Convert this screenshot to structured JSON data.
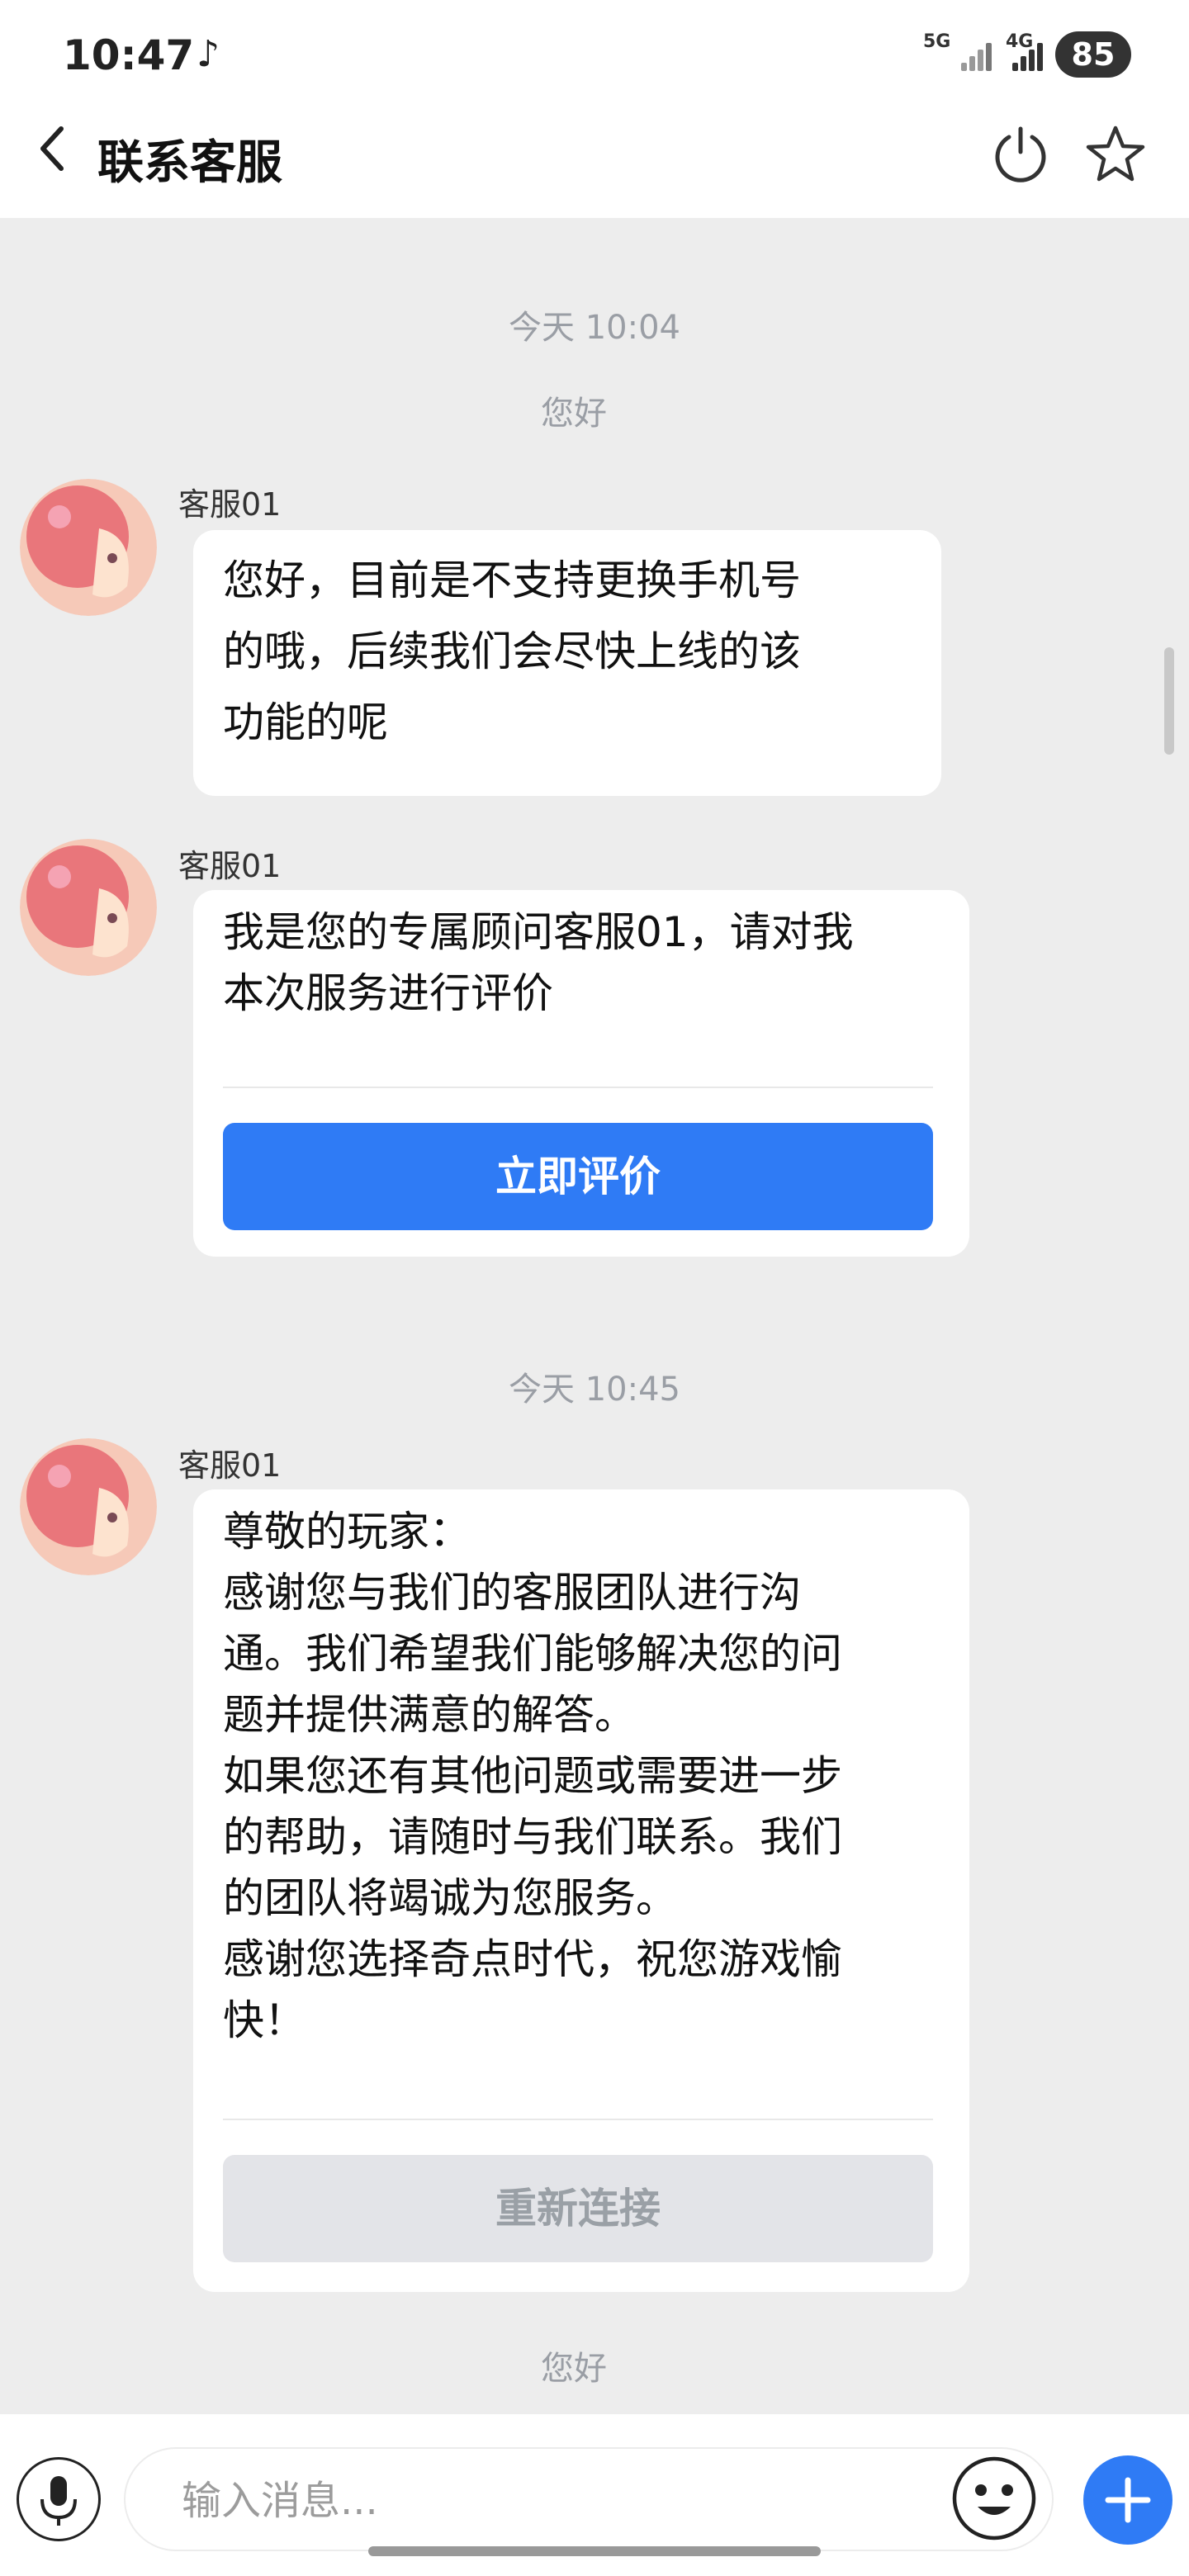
{
  "status_bar": {
    "time": "10:47",
    "network_1": "5G",
    "network_2": "4G",
    "battery": "85"
  },
  "header": {
    "title": "联系客服"
  },
  "chat": {
    "time_1": "今天 10:04",
    "sys_1": "您好",
    "msg_1": {
      "sender": "客服01",
      "text": "您好，目前是不支持更换手机号\n的哦，后续我们会尽快上线的该\n功能的呢"
    },
    "msg_2": {
      "sender": "客服01",
      "text": "我是您的专属顾问客服01，请对我\n本次服务进行评价",
      "button": "立即评价"
    },
    "time_2": "今天 10:45",
    "msg_3": {
      "sender": "客服01",
      "text": "尊敬的玩家：\n感谢您与我们的客服团队进行沟\n通。我们希望我们能够解决您的问\n题并提供满意的解答。\n如果您还有其他问题或需要进一步\n的帮助，请随时与我们联系。我们\n的团队将竭诚为您服务。\n感谢您选择奇点时代，祝您游戏愉\n快！",
      "button": "重新连接"
    },
    "sys_2": "您好"
  },
  "input": {
    "placeholder": "输入消息..."
  },
  "icons": {
    "tiktok": "tiktok-icon",
    "back": "chevron-left-icon",
    "power": "power-icon",
    "star": "star-icon",
    "mic": "microphone-icon",
    "emoji": "emoji-icon",
    "plus": "plus-icon"
  },
  "colors": {
    "accent": "#2f7bf5",
    "background": "#ededed",
    "bubble": "#ffffff"
  }
}
